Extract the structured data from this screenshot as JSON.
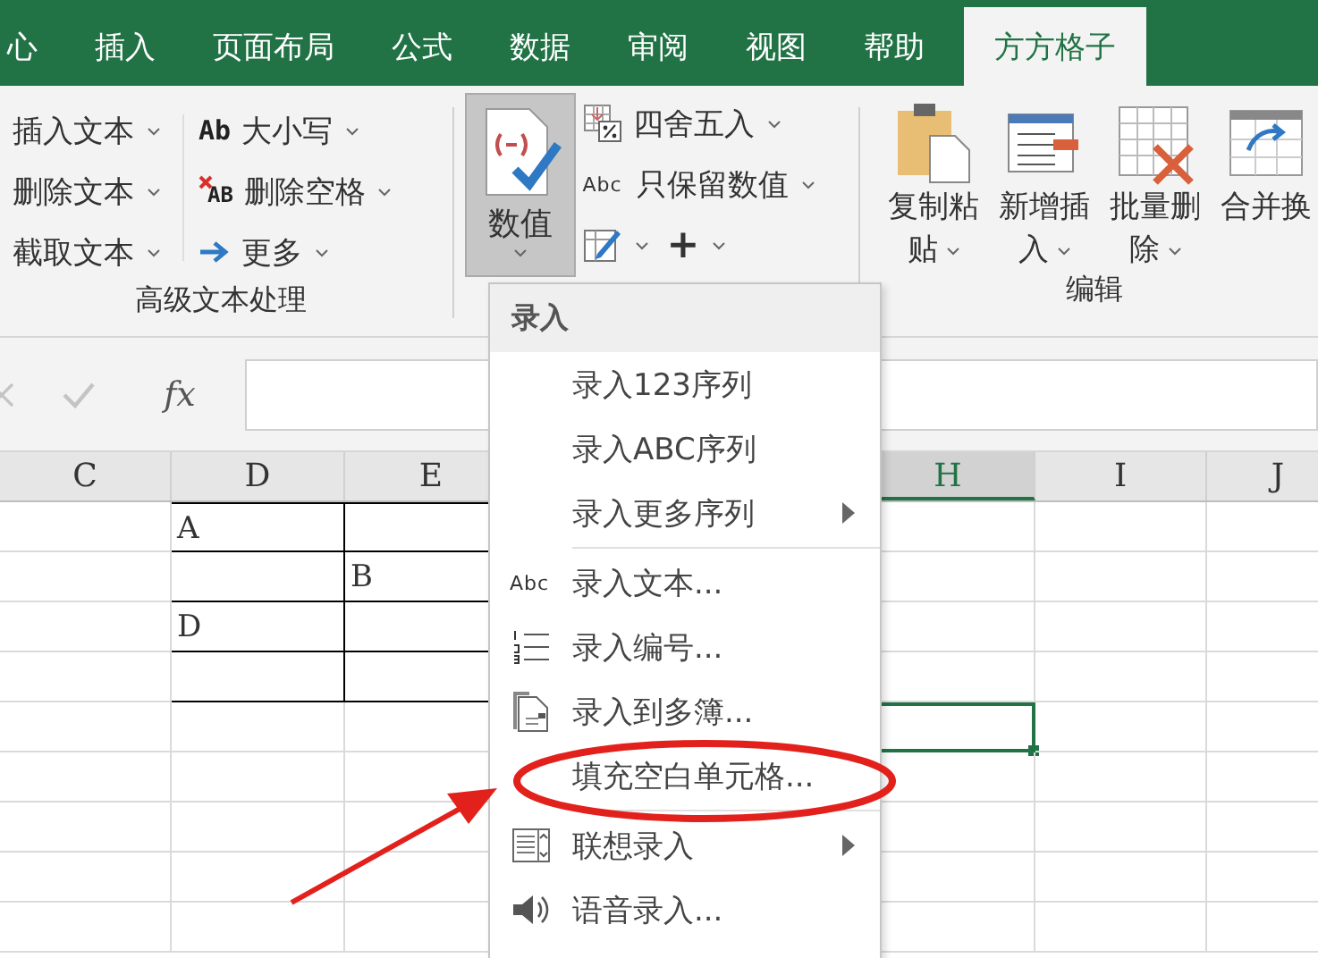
{
  "tabs": [
    {
      "label": "心",
      "selected": false
    },
    {
      "label": "插入",
      "selected": false
    },
    {
      "label": "页面布局",
      "selected": false
    },
    {
      "label": "公式",
      "selected": false
    },
    {
      "label": "数据",
      "selected": false
    },
    {
      "label": "审阅",
      "selected": false
    },
    {
      "label": "视图",
      "selected": false
    },
    {
      "label": "帮助",
      "selected": false
    },
    {
      "label": "方方格子",
      "selected": true
    }
  ],
  "ribbon": {
    "text_group": {
      "label": "高级文本处理",
      "left_items": [
        {
          "label": "插入文本",
          "dropdown": true
        },
        {
          "label": "删除文本",
          "dropdown": true
        },
        {
          "label": "截取文本",
          "dropdown": true
        }
      ],
      "right_items": [
        {
          "icon_text": "Ab",
          "label": "大小写",
          "dropdown": true
        },
        {
          "icon_text": "AB",
          "label": "删除空格",
          "dropdown": true
        },
        {
          "label": "更多",
          "dropdown": true
        }
      ]
    },
    "number_group": {
      "large_button": {
        "label": "数值",
        "pressed": true,
        "dropdown": true
      },
      "items": [
        {
          "label": "四舍五入",
          "dropdown": true
        },
        {
          "icon_text": "Abc",
          "label": "只保留数值",
          "dropdown": true
        }
      ],
      "small_buttons": [
        {
          "dropdown": true
        },
        {
          "label": "+",
          "dropdown": true
        }
      ]
    },
    "edit_group": {
      "label": "编辑",
      "buttons": [
        {
          "label": "复制粘贴",
          "dropdown": true
        },
        {
          "label": "新增插入",
          "dropdown": true
        },
        {
          "label": "批量删除",
          "dropdown": true
        },
        {
          "label": "合并换",
          "dropdown": false
        }
      ]
    }
  },
  "formula_bar": {
    "fx": "fx"
  },
  "sheet": {
    "columns": [
      {
        "label": "C",
        "selected": false
      },
      {
        "label": "D",
        "selected": false
      },
      {
        "label": "E",
        "selected": false
      },
      {
        "label": "H",
        "selected": true
      },
      {
        "label": "I",
        "selected": false
      },
      {
        "label": "J",
        "selected": false
      }
    ],
    "rows": [
      {
        "cells": [
          {
            "bordered": false,
            "selected": false
          },
          {
            "bordered": true,
            "selected": false,
            "text": "A"
          },
          {
            "bordered": true,
            "selected": false
          },
          {
            "bordered": false,
            "selected": false
          },
          {
            "bordered": false,
            "selected": false
          },
          {
            "bordered": false,
            "selected": false
          }
        ]
      },
      {
        "cells": [
          {
            "bordered": false,
            "selected": false
          },
          {
            "bordered": true,
            "selected": false
          },
          {
            "bordered": true,
            "selected": false,
            "text": "B"
          },
          {
            "bordered": false,
            "selected": false
          },
          {
            "bordered": false,
            "selected": false
          },
          {
            "bordered": false,
            "selected": false
          }
        ]
      },
      {
        "cells": [
          {
            "bordered": false,
            "selected": false
          },
          {
            "bordered": true,
            "selected": false,
            "text": "D"
          },
          {
            "bordered": true,
            "selected": false
          },
          {
            "bordered": false,
            "selected": false
          },
          {
            "bordered": false,
            "selected": false
          },
          {
            "bordered": false,
            "selected": false
          }
        ]
      },
      {
        "cells": [
          {
            "bordered": false,
            "selected": false
          },
          {
            "bordered": true,
            "selected": false
          },
          {
            "bordered": true,
            "selected": false
          },
          {
            "bordered": false,
            "selected": false
          },
          {
            "bordered": false,
            "selected": false
          },
          {
            "bordered": false,
            "selected": false
          }
        ]
      },
      {
        "cells": [
          {
            "bordered": false,
            "selected": false
          },
          {
            "bordered": false,
            "selected": false
          },
          {
            "bordered": false,
            "selected": false
          },
          {
            "bordered": false,
            "selected": true
          },
          {
            "bordered": false,
            "selected": false
          },
          {
            "bordered": false,
            "selected": false
          }
        ]
      },
      {
        "cells": [
          {
            "bordered": false,
            "selected": false
          },
          {
            "bordered": false,
            "selected": false
          },
          {
            "bordered": false,
            "selected": false
          },
          {
            "bordered": false,
            "selected": false
          },
          {
            "bordered": false,
            "selected": false
          },
          {
            "bordered": false,
            "selected": false
          }
        ]
      },
      {
        "cells": [
          {
            "bordered": false,
            "selected": false
          },
          {
            "bordered": false,
            "selected": false
          },
          {
            "bordered": false,
            "selected": false
          },
          {
            "bordered": false,
            "selected": false
          },
          {
            "bordered": false,
            "selected": false
          },
          {
            "bordered": false,
            "selected": false
          }
        ]
      },
      {
        "cells": [
          {
            "bordered": false,
            "selected": false
          },
          {
            "bordered": false,
            "selected": false
          },
          {
            "bordered": false,
            "selected": false
          },
          {
            "bordered": false,
            "selected": false
          },
          {
            "bordered": false,
            "selected": false
          },
          {
            "bordered": false,
            "selected": false
          }
        ]
      },
      {
        "cells": [
          {
            "bordered": false,
            "selected": false
          },
          {
            "bordered": false,
            "selected": false
          },
          {
            "bordered": false,
            "selected": false
          },
          {
            "bordered": false,
            "selected": false
          },
          {
            "bordered": false,
            "selected": false
          },
          {
            "bordered": false,
            "selected": false
          }
        ]
      }
    ]
  },
  "menu": {
    "title": "录入",
    "sections": [
      [
        {
          "kind": "plain",
          "label": "录入123序列",
          "submenu": false
        },
        {
          "kind": "plain",
          "label": "录入ABC序列",
          "submenu": false
        },
        {
          "kind": "plain",
          "label": "录入更多序列",
          "submenu": true
        }
      ],
      [
        {
          "kind": "text",
          "icon_text": "Abc",
          "label": "录入文本...",
          "submenu": false
        },
        {
          "kind": "number",
          "label": "录入编号...",
          "submenu": false
        },
        {
          "kind": "workbook",
          "label": "录入到多簿...",
          "submenu": false
        },
        {
          "kind": "plain",
          "label": "填充空白单元格...",
          "submenu": false
        }
      ],
      [
        {
          "kind": "associate",
          "label": "联想录入",
          "submenu": true
        },
        {
          "kind": "voice",
          "label": "语音录入...",
          "submenu": false
        }
      ]
    ]
  },
  "annotations": {
    "highlight_oval": true,
    "arrow": true
  }
}
